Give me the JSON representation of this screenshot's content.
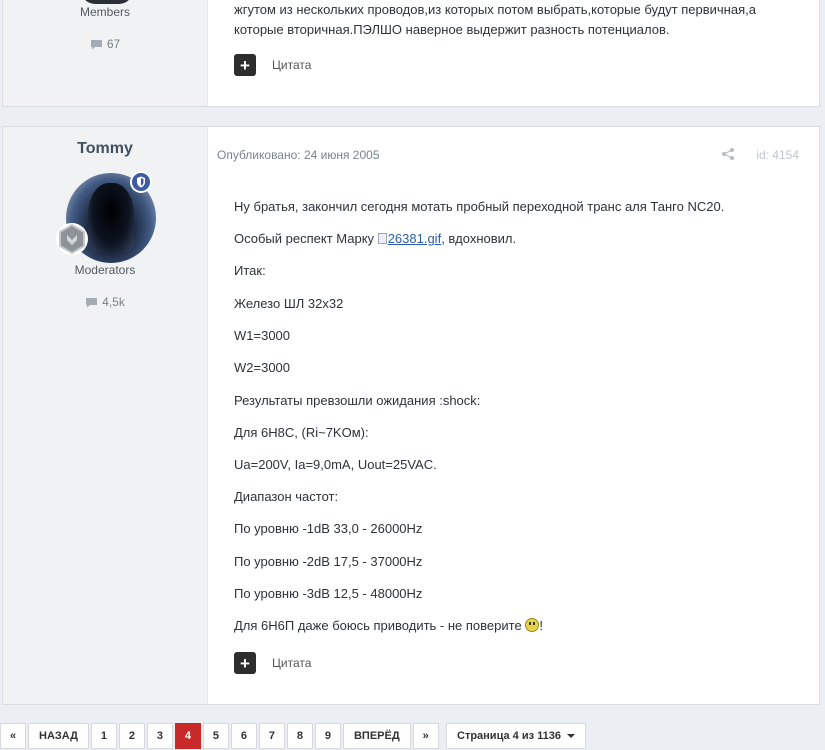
{
  "prev_post": {
    "author_group": "Members",
    "post_count": "67",
    "text_line1": "жгутом из нескольких проводов,из которых потом выбрать,которые будут первичная,а",
    "text_line2": "которые вторичная.ПЭЛШО наверное выдержит разность потенциалов.",
    "quote_label": "Цитата"
  },
  "post": {
    "username": "Tommy",
    "group": "Moderators",
    "post_count": "4,5k",
    "posted_label": "Опубликовано: 24 июня 2005",
    "post_id": "id: 4154",
    "lines": [
      "Ну братья, закончил сегодня мотать пробный переходной транс аля Танго NC20.",
      "Особый респект Марку",
      "Итак:",
      "Железо ШЛ 32x32",
      "W1=3000",
      "W2=3000",
      "Результаты превзошли ожидания :shock:",
      "Для 6Н8С, (Ri~7KОм):",
      "Ua=200V, Ia=9,0mA, Uout=25VAC.",
      "Диапазон частот:",
      "По уровню -1dB 33,0 - 26000Hz",
      "По уровню -2dB 17,5 - 37000Hz",
      "По уровню -3dB 12,5 - 48000Hz",
      "Для 6Н6П даже боюсь приводить - не поверите"
    ],
    "image_link": "26381.gif",
    "after_link": ", вдохновил.",
    "after_smiley": "!",
    "quote_label": "Цитата",
    "icons": {
      "share": "share-icon",
      "moderator": "shield-icon",
      "rank": "rank-badge-icon",
      "comments": "comment-icon"
    }
  },
  "pagination": {
    "first": "«",
    "prev": "НАЗАД",
    "pages": [
      "1",
      "2",
      "3",
      "4",
      "5",
      "6",
      "7",
      "8",
      "9"
    ],
    "current": "4",
    "next": "ВПЕРЁД",
    "last": "»",
    "page_select": "Страница 4 из 1136"
  },
  "colors": {
    "active_page": "#c82a2a",
    "moderator_badge": "#3b5ba5",
    "author_bg": "#f1f2f4"
  }
}
